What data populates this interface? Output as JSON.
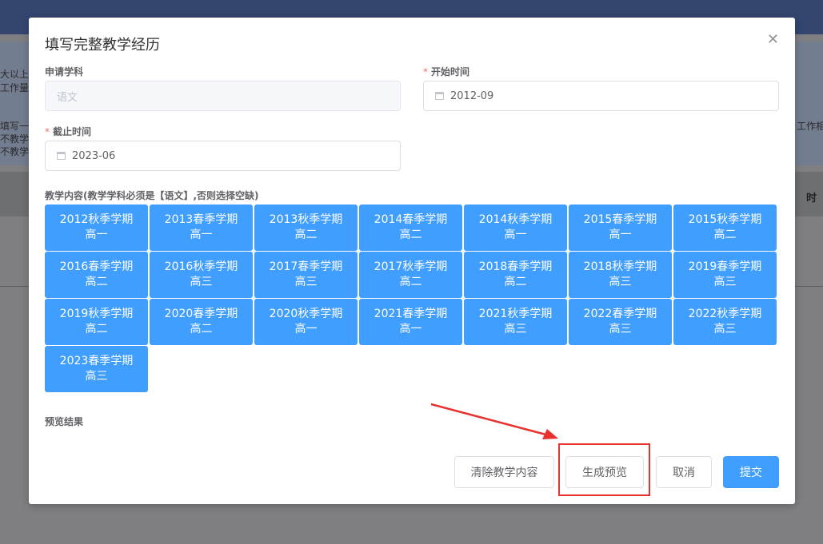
{
  "background": {
    "left_lines": [
      "大以上须",
      "工作量",
      "填写一",
      "不教学经",
      "不教学经"
    ],
    "right_line": "工作相应",
    "column_title": "时"
  },
  "modal": {
    "title": "填写完整教学经历",
    "close_icon": "close-icon",
    "subject": {
      "label": "申请学科",
      "value": "语文"
    },
    "start": {
      "label": "开始时间",
      "value": "2012-09",
      "required": "*"
    },
    "end": {
      "label": "截止时间",
      "value": "2023-06",
      "required": "*"
    },
    "content_label": "教学内容(教学学科必须是【语文】,否则选择空缺)",
    "semesters": [
      {
        "term": "2012秋季学期",
        "grade": "高一"
      },
      {
        "term": "2013春季学期",
        "grade": "高一"
      },
      {
        "term": "2013秋季学期",
        "grade": "高二"
      },
      {
        "term": "2014春季学期",
        "grade": "高二"
      },
      {
        "term": "2014秋季学期",
        "grade": "高一"
      },
      {
        "term": "2015春季学期",
        "grade": "高一"
      },
      {
        "term": "2015秋季学期",
        "grade": "高二"
      },
      {
        "term": "2016春季学期",
        "grade": "高二"
      },
      {
        "term": "2016秋季学期",
        "grade": "高三"
      },
      {
        "term": "2017春季学期",
        "grade": "高三"
      },
      {
        "term": "2017秋季学期",
        "grade": "高二"
      },
      {
        "term": "2018春季学期",
        "grade": "高二"
      },
      {
        "term": "2018秋季学期",
        "grade": "高三"
      },
      {
        "term": "2019春季学期",
        "grade": "高三"
      },
      {
        "term": "2019秋季学期",
        "grade": "高二"
      },
      {
        "term": "2020春季学期",
        "grade": "高二"
      },
      {
        "term": "2020秋季学期",
        "grade": "高一"
      },
      {
        "term": "2021春季学期",
        "grade": "高一"
      },
      {
        "term": "2021秋季学期",
        "grade": "高三"
      },
      {
        "term": "2022春季学期",
        "grade": "高三"
      },
      {
        "term": "2022秋季学期",
        "grade": "高三"
      },
      {
        "term": "2023春季学期",
        "grade": "高三"
      }
    ],
    "preview_label": "预览结果",
    "buttons": {
      "clear": "清除教学内容",
      "preview": "生成预览",
      "cancel": "取消",
      "submit": "提交"
    }
  },
  "colors": {
    "accent": "#409eff",
    "annotation": "#e8322f"
  }
}
